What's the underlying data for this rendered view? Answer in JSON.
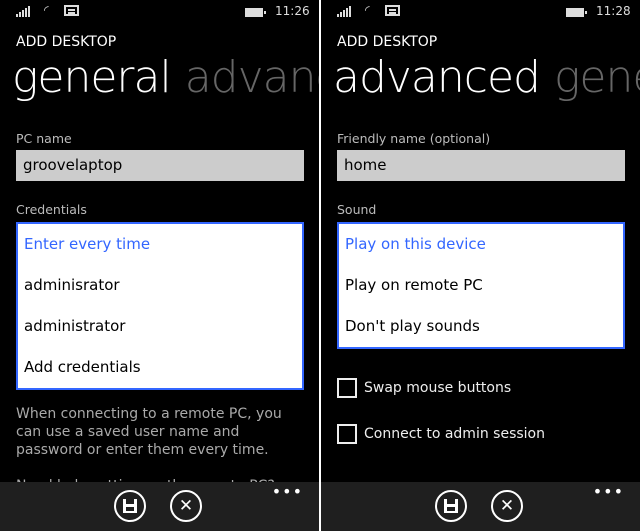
{
  "left": {
    "time": "11:26",
    "app_title": "ADD DESKTOP",
    "pivot_active": "general",
    "pivot_next": "advanced",
    "pc_name_label": "PC name",
    "pc_name_value": "groovelaptop",
    "credentials_label": "Credentials",
    "credentials_options": [
      "Enter every time",
      "adminisrator",
      "administrator",
      "Add credentials"
    ],
    "help_text": "When connecting to a remote PC, you can use a saved user name and password or enter them every time.",
    "help_link": "Need help setting up the remote PC?",
    "appbar": {
      "save": "save-icon",
      "cancel": "close-icon",
      "more": "•••"
    }
  },
  "right": {
    "time": "11:28",
    "app_title": "ADD DESKTOP",
    "pivot_active": "advanced",
    "pivot_next": "general",
    "friendly_label": "Friendly name (optional)",
    "friendly_value": "home",
    "sound_label": "Sound",
    "sound_options": [
      "Play on this device",
      "Play on remote PC",
      "Don't play sounds"
    ],
    "swap_mouse": "Swap mouse buttons",
    "admin_session": "Connect to admin session",
    "appbar": {
      "save": "save-icon",
      "cancel": "close-icon",
      "more": "•••"
    }
  },
  "colors": {
    "accent": "#3366ff",
    "background": "#000000",
    "appbar": "#1f1f1f"
  }
}
